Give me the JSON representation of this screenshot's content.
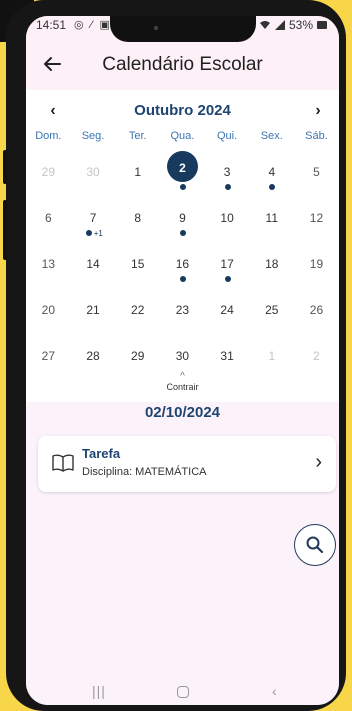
{
  "status_bar": {
    "time": "14:51",
    "left_icons": "◎ ⁄ ▣",
    "right_text": "53%"
  },
  "app_bar": {
    "title": "Calendário Escolar",
    "back_icon": "arrow-left"
  },
  "calendar": {
    "month_label": "Outubro 2024",
    "prev_label": "‹",
    "next_label": "›",
    "weekdays": [
      "Dom.",
      "Seg.",
      "Ter.",
      "Qua.",
      "Qui.",
      "Sex.",
      "Sáb."
    ],
    "weeks": [
      [
        "29",
        "30",
        "1",
        "2",
        "3",
        "4",
        "5"
      ],
      [
        "6",
        "7",
        "8",
        "9",
        "10",
        "11",
        "12"
      ],
      [
        "13",
        "14",
        "15",
        "16",
        "17",
        "18",
        "19"
      ],
      [
        "20",
        "21",
        "22",
        "23",
        "24",
        "25",
        "26"
      ],
      [
        "27",
        "28",
        "29",
        "30",
        "31",
        "1",
        "2"
      ]
    ],
    "selected_day": "2",
    "extra_events_label": "+1",
    "collapse_label": "Contrair",
    "accent_color": "#173a5e"
  },
  "selected_date": "02/10/2024",
  "task": {
    "title": "Tarefa",
    "subject": "Disciplina: MATEMÁTICA",
    "icon": "book-icon"
  },
  "nav": {
    "recents": "|||",
    "back": "‹"
  }
}
